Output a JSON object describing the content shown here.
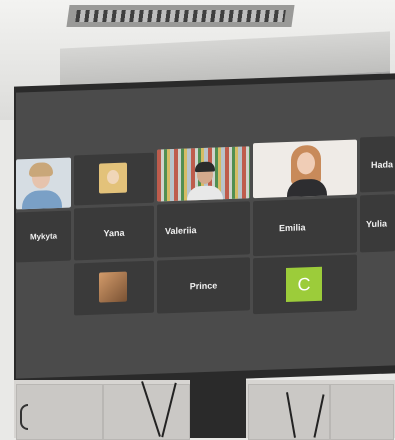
{
  "tiles": {
    "row2": [
      {
        "name": "Mykyta"
      },
      {
        "name": "Yana"
      },
      {
        "name": "Valeriia"
      },
      {
        "name": "Emilia"
      },
      {
        "name": "Yulia"
      }
    ],
    "row1_partial_name": "Hada",
    "row3": [
      {
        "name": "Prince"
      },
      {
        "avatar_letter": "C",
        "avatar_color": "#9ccc3a"
      }
    ]
  }
}
